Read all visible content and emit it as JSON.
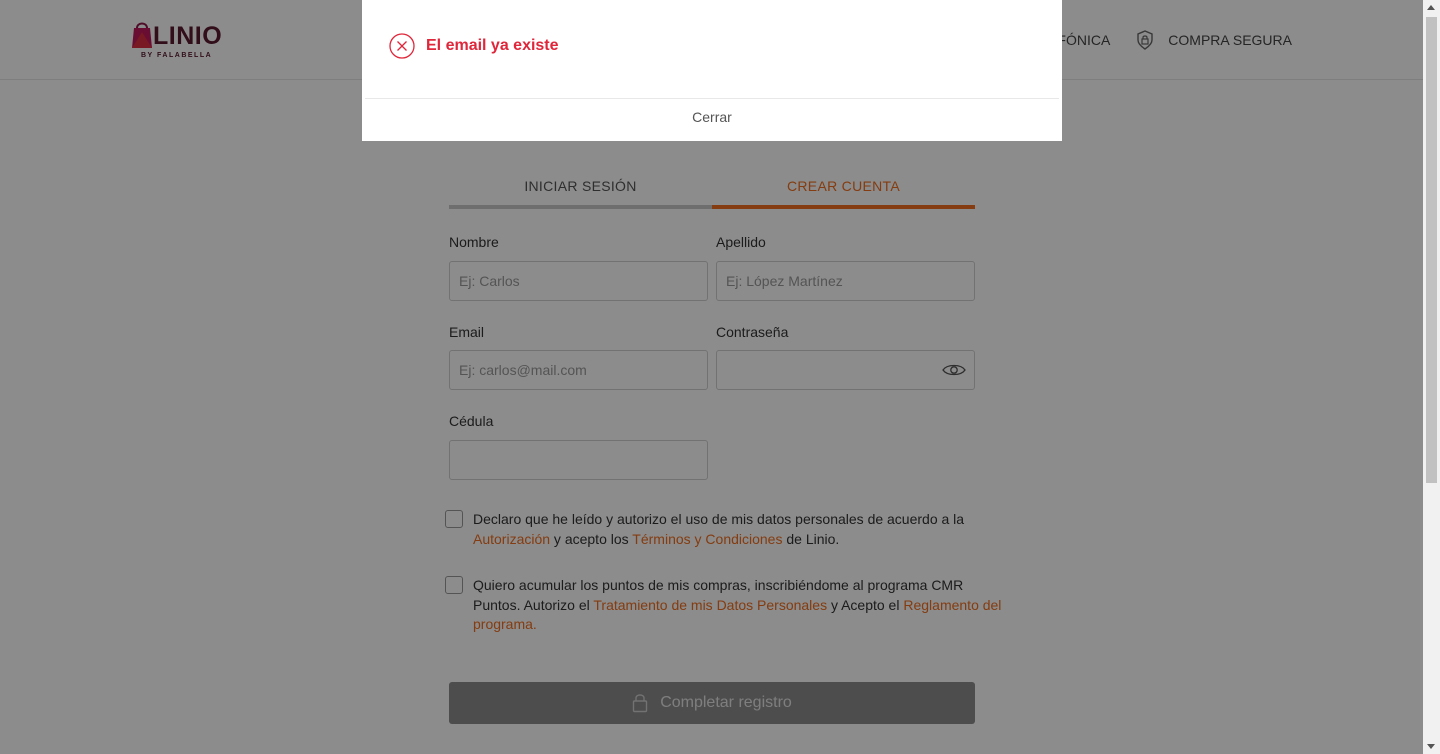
{
  "header": {
    "logo_text": "LINIO",
    "logo_subtext": "BY FALABELLA",
    "links": [
      {
        "label": "EFÓNICA",
        "icon": "phone-icon"
      },
      {
        "label": "COMPRA SEGURA",
        "icon": "shield-icon"
      }
    ]
  },
  "tabs": [
    {
      "label": "INICIAR SESIÓN",
      "active": false
    },
    {
      "label": "CREAR CUENTA",
      "active": true
    }
  ],
  "form": {
    "nombre": {
      "label": "Nombre",
      "placeholder": "Ej: Carlos",
      "value": ""
    },
    "apellido": {
      "label": "Apellido",
      "placeholder": "Ej: López Martínez",
      "value": ""
    },
    "email": {
      "label": "Email",
      "placeholder": "Ej: carlos@mail.com",
      "value": ""
    },
    "password": {
      "label": "Contraseña",
      "placeholder": "",
      "value": ""
    },
    "cedula": {
      "label": "Cédula",
      "placeholder": "",
      "value": ""
    }
  },
  "consents": [
    {
      "text_1": "Declaro que he leído y autorizo el uso de mis datos personales de acuerdo a la ",
      "link_1": "Autorización",
      "text_2": " y acepto los ",
      "link_2": "Términos y Condiciones",
      "text_3": " de Linio.",
      "checked": false
    },
    {
      "text_1": "Quiero acumular los puntos de mis compras, inscribiéndome al programa CMR Puntos. Autorizo el ",
      "link_1": "Tratamiento de mis Datos Personales",
      "text_2": " y Acepto el ",
      "link_2": "Reglamento del programa.",
      "checked": false
    }
  ],
  "submit_label": "Completar registro",
  "modal": {
    "message": "El email ya existe",
    "close_label": "Cerrar"
  },
  "colors": {
    "accent": "#f06e1e",
    "error": "#e0263a",
    "brand": "#5a1a2e"
  }
}
